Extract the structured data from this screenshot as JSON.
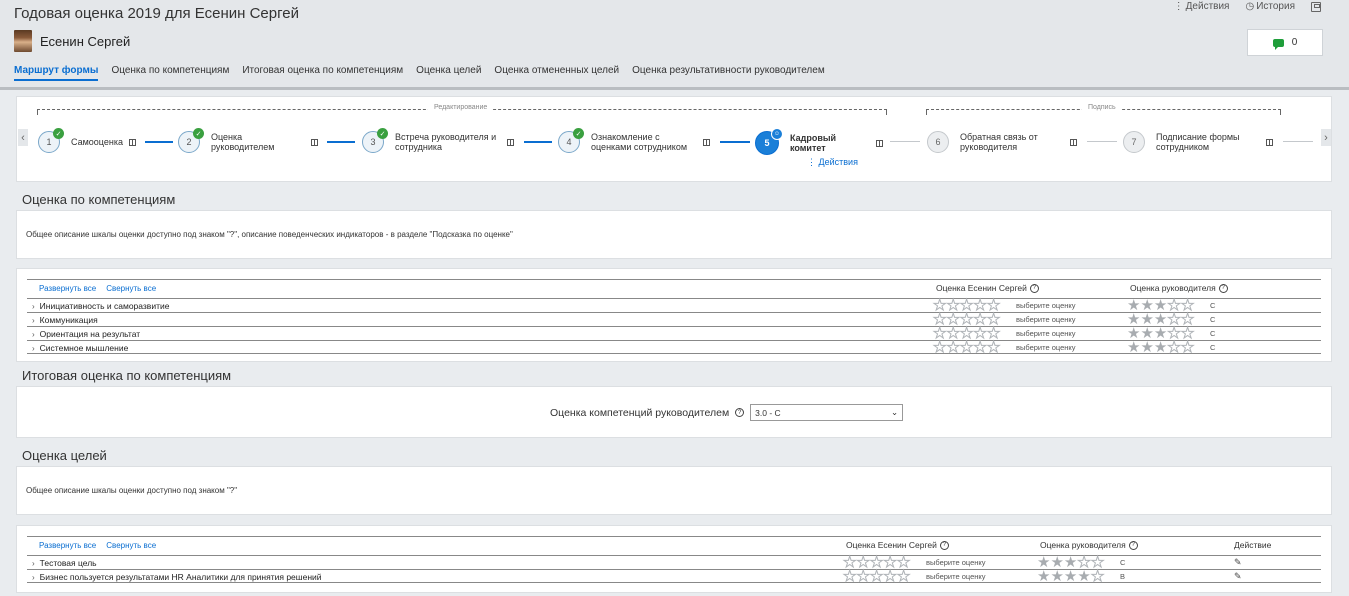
{
  "header": {
    "title": "Годовая оценка 2019 для Есенин Сергей",
    "person_name": "Есенин Сергей",
    "actions": [
      {
        "icon": "more-vertical-icon",
        "label": "Действия"
      },
      {
        "icon": "clock-icon",
        "label": "История"
      },
      {
        "icon": "save-icon",
        "label": ""
      }
    ],
    "comments_count": "0",
    "tabs": [
      "Маршрут формы",
      "Оценка по компетенциям",
      "Итоговая оценка по компетенциям",
      "Оценка целей",
      "Оценка отмененных целей",
      "Оценка результативности руководителем"
    ],
    "active_tab": 0
  },
  "process": {
    "groups": [
      "Редактирование",
      "Подпись"
    ],
    "steps": [
      {
        "num": "1",
        "label": "Самооценка",
        "state": "done"
      },
      {
        "num": "2",
        "label": "Оценка руководителем",
        "state": "done"
      },
      {
        "num": "3",
        "label": "Встреча руководителя и сотрудника",
        "state": "done"
      },
      {
        "num": "4",
        "label": "Ознакомление с оценками сотрудником",
        "state": "done"
      },
      {
        "num": "5",
        "label": "Кадровый комитет",
        "state": "current"
      },
      {
        "num": "6",
        "label": "Обратная связь от руководителя",
        "state": "pending"
      },
      {
        "num": "7",
        "label": "Подписание формы сотрудником",
        "state": "pending"
      }
    ],
    "current_actions_label": "Действия"
  },
  "competencies": {
    "title": "Оценка по компетенциям",
    "info": "Общее описание шкалы оценки доступно под знаком \"?\", описание поведенческих индикаторов - в разделе \"Подсказка по оценке\"",
    "expand_all": "Развернуть все",
    "collapse_all": "Свернуть все",
    "col_self": "Оценка Есенин Сергей",
    "col_manager": "Оценка руководителя",
    "rows": [
      {
        "name": "Инициативность и саморазвитие",
        "self_label": "выберите оценку",
        "manager_stars": 3,
        "manager_label": "C"
      },
      {
        "name": "Коммуникация",
        "self_label": "выберите оценку",
        "manager_stars": 3,
        "manager_label": "C"
      },
      {
        "name": "Ориентация на результат",
        "self_label": "выберите оценку",
        "manager_stars": 3,
        "manager_label": "C"
      },
      {
        "name": "Системное мышление",
        "self_label": "выберите оценку",
        "manager_stars": 3,
        "manager_label": "C"
      }
    ]
  },
  "summary": {
    "title": "Итоговая оценка по компетенциям",
    "label": "Оценка компетенций руководителем",
    "value": "3.0 - C"
  },
  "goals": {
    "title": "Оценка целей",
    "info": "Общее описание шкалы оценки доступно под знаком \"?\"",
    "expand_all": "Развернуть все",
    "collapse_all": "Свернуть все",
    "col_self": "Оценка Есенин Сергей",
    "col_manager": "Оценка руководителя",
    "col_action": "Действие",
    "rows": [
      {
        "name": "Тестовая цель",
        "self_label": "выберите оценку",
        "manager_stars": 3,
        "manager_label": "C"
      },
      {
        "name": "Бизнес пользуется результатами HR Аналитики для принятия решений",
        "self_label": "выберите оценку",
        "manager_stars": 4,
        "manager_label": "B"
      }
    ]
  }
}
